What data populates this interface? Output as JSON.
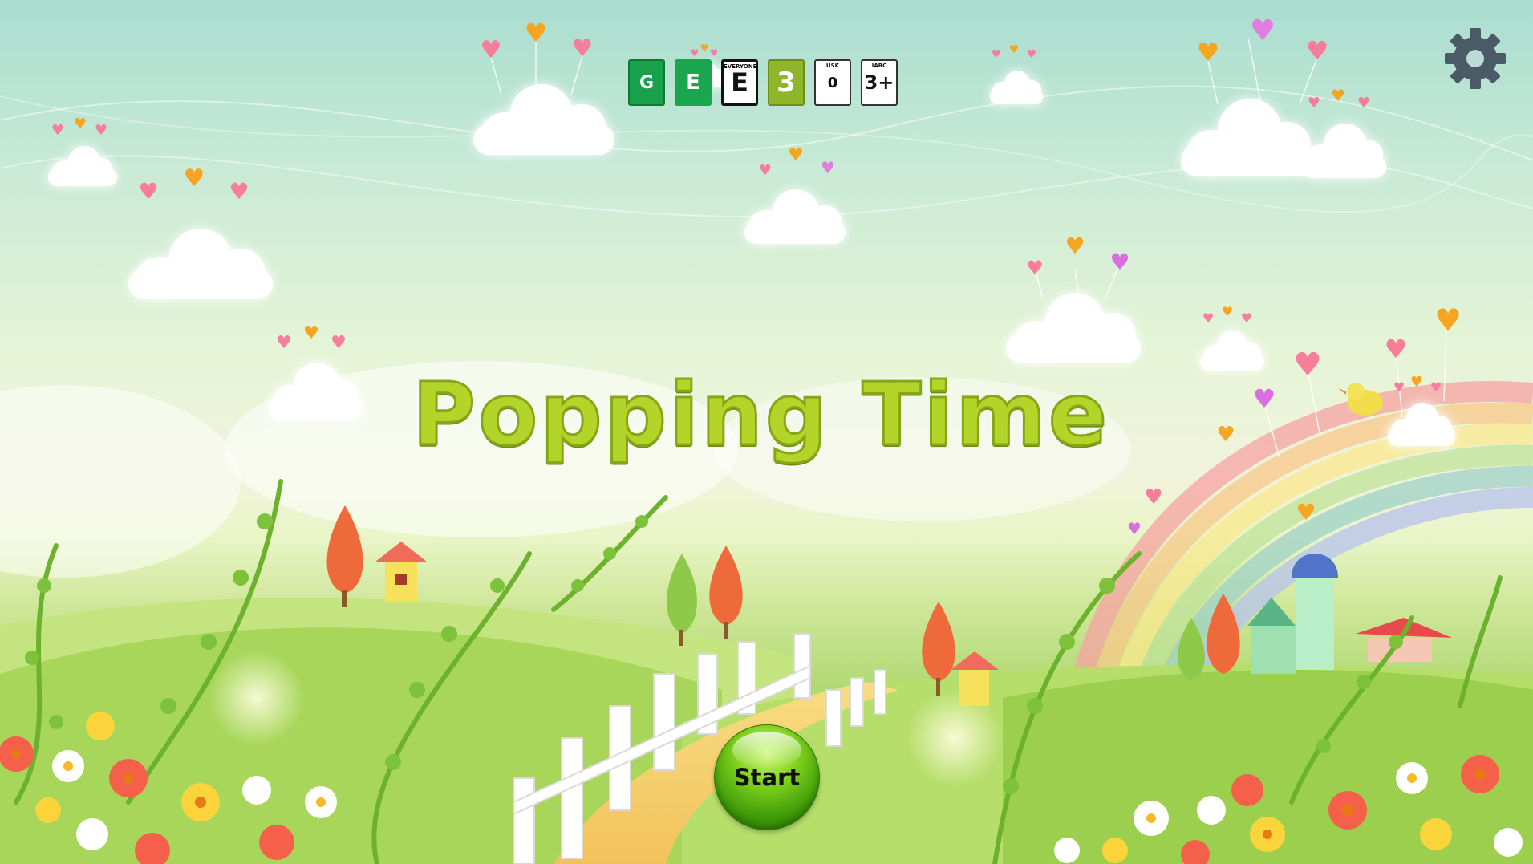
{
  "title": "Popping Time",
  "start_label": "Start",
  "settings_icon": "gear-icon",
  "ratings": [
    {
      "label": "G",
      "sub": "",
      "icon": "rating-g-badge"
    },
    {
      "label": "E",
      "sub": "",
      "icon": "rating-pegi-badge"
    },
    {
      "label": "E",
      "sub": "EVERYONE",
      "icon": "rating-esrb-badge"
    },
    {
      "label": "3",
      "sub": "",
      "icon": "rating-pegi3-badge"
    },
    {
      "label": "0",
      "sub": "USK",
      "icon": "rating-usk-badge"
    },
    {
      "label": "3+",
      "sub": "IARC",
      "icon": "rating-iarc-badge"
    }
  ],
  "colors": {
    "title_fill": "#b4d42a",
    "title_outline": "#86a715",
    "start_button": "#5cb80f",
    "gear": "#4a5a66"
  }
}
